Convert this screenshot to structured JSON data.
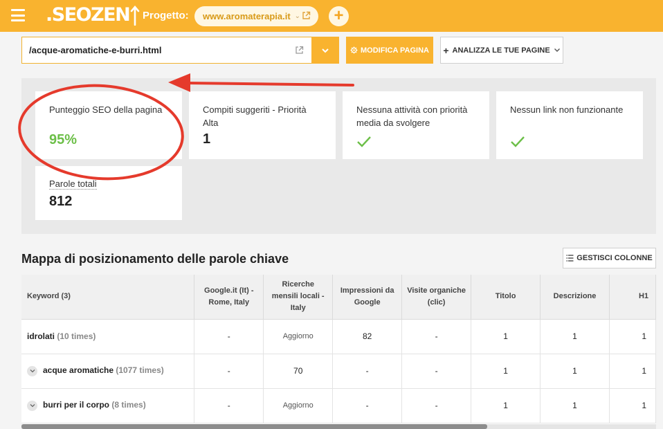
{
  "topbar": {
    "logo_text": ".SEOZEN",
    "project_label": "Progetto:",
    "project_name": "www.aromaterapia.it",
    "add_symbol": "+"
  },
  "toolbar": {
    "url_value": "/acque-aromatiche-e-burri.html",
    "edit_page_label": "MODIFICA PAGINA",
    "analyze_pages_label": "ANALIZZA LE TUE PAGINE"
  },
  "stats": {
    "seo_score": {
      "label": "Punteggio SEO della pagina",
      "value": "95%"
    },
    "high_priority": {
      "label": "Compiti suggeriti - Priorità Alta",
      "value": "1"
    },
    "medium_priority": {
      "label": "Nessuna attività con priorità media da svolgere",
      "icon": "check-icon"
    },
    "broken_links": {
      "label": "Nessun link non funzionante",
      "icon": "check-icon"
    },
    "total_words": {
      "label": "Parole totali",
      "value": "812"
    }
  },
  "keywords": {
    "title": "Mappa di posizionamento delle parole chiave",
    "manage_columns_label": "GESTISCI COLONNE",
    "columns": [
      "Keyword (3)",
      "Google.it (It) - Rome, Italy",
      "Ricerche mensili locali - Italy",
      "Impressioni da Google",
      "Visite organiche (clic)",
      "Titolo",
      "Descrizione",
      "H1"
    ],
    "rows": [
      {
        "keyword": "idrolati",
        "times": "(10 times)",
        "expandable": false,
        "cells": [
          "-",
          "Aggiorno",
          "82",
          "-",
          "1",
          "1",
          "1"
        ]
      },
      {
        "keyword": "acque aromatiche",
        "times": "(1077 times)",
        "expandable": true,
        "cells": [
          "-",
          "70",
          "-",
          "-",
          "1",
          "1",
          "1"
        ]
      },
      {
        "keyword": "burri per il corpo",
        "times": "(8 times)",
        "expandable": true,
        "cells": [
          "-",
          "Aggiorno",
          "-",
          "-",
          "1",
          "1",
          "1"
        ]
      }
    ]
  },
  "colors": {
    "brand": "#f9b32f",
    "score_green": "#6cbf48",
    "annotation_red": "#e53a2c"
  }
}
